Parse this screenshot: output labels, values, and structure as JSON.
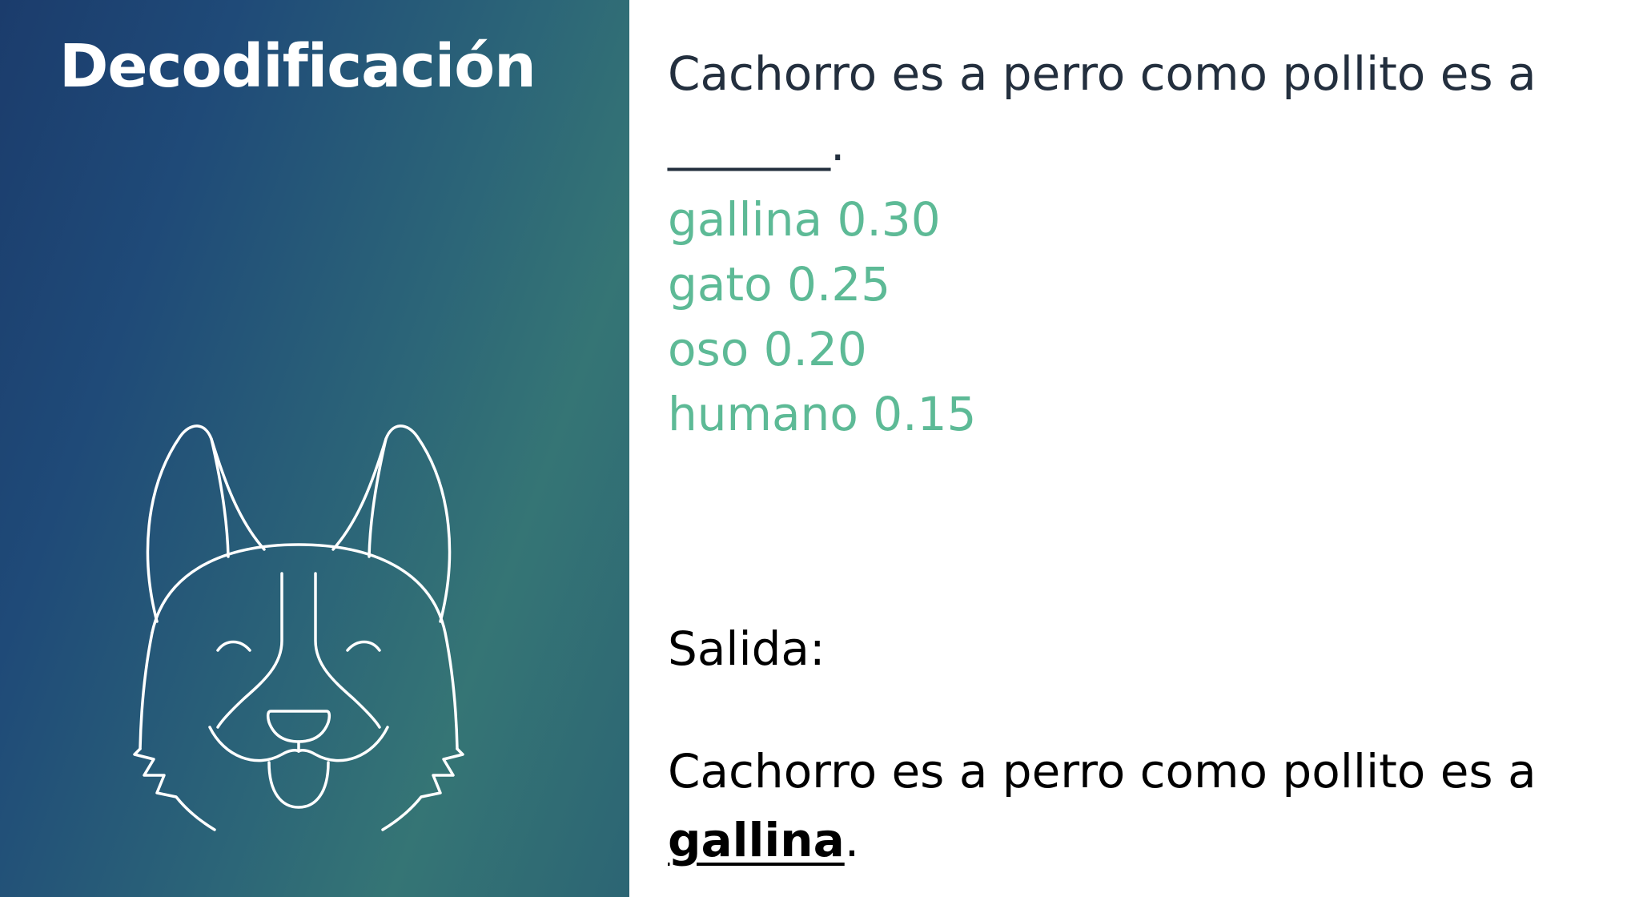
{
  "slide": {
    "title": "Decodificación",
    "prompt": {
      "text": "Cachorro es a perro como pollito es a",
      "blank": "_______."
    },
    "candidates": [
      {
        "word": "gallina",
        "probability": "0.30"
      },
      {
        "word": "gato",
        "probability": "0.25"
      },
      {
        "word": "oso",
        "probability": "0.20"
      },
      {
        "word": "humano",
        "probability": "0.15"
      }
    ],
    "output_label": "Salida:",
    "output": {
      "text": "Cachorro es a perro como pollito es a",
      "answer": "gallina",
      "end": "."
    }
  },
  "icons": {
    "illustration": "dog-face-icon"
  },
  "colors": {
    "panel_start": "#1b3c6c",
    "panel_end": "#357575",
    "candidate_text": "#5dba96",
    "prompt_text": "#232f3e"
  }
}
